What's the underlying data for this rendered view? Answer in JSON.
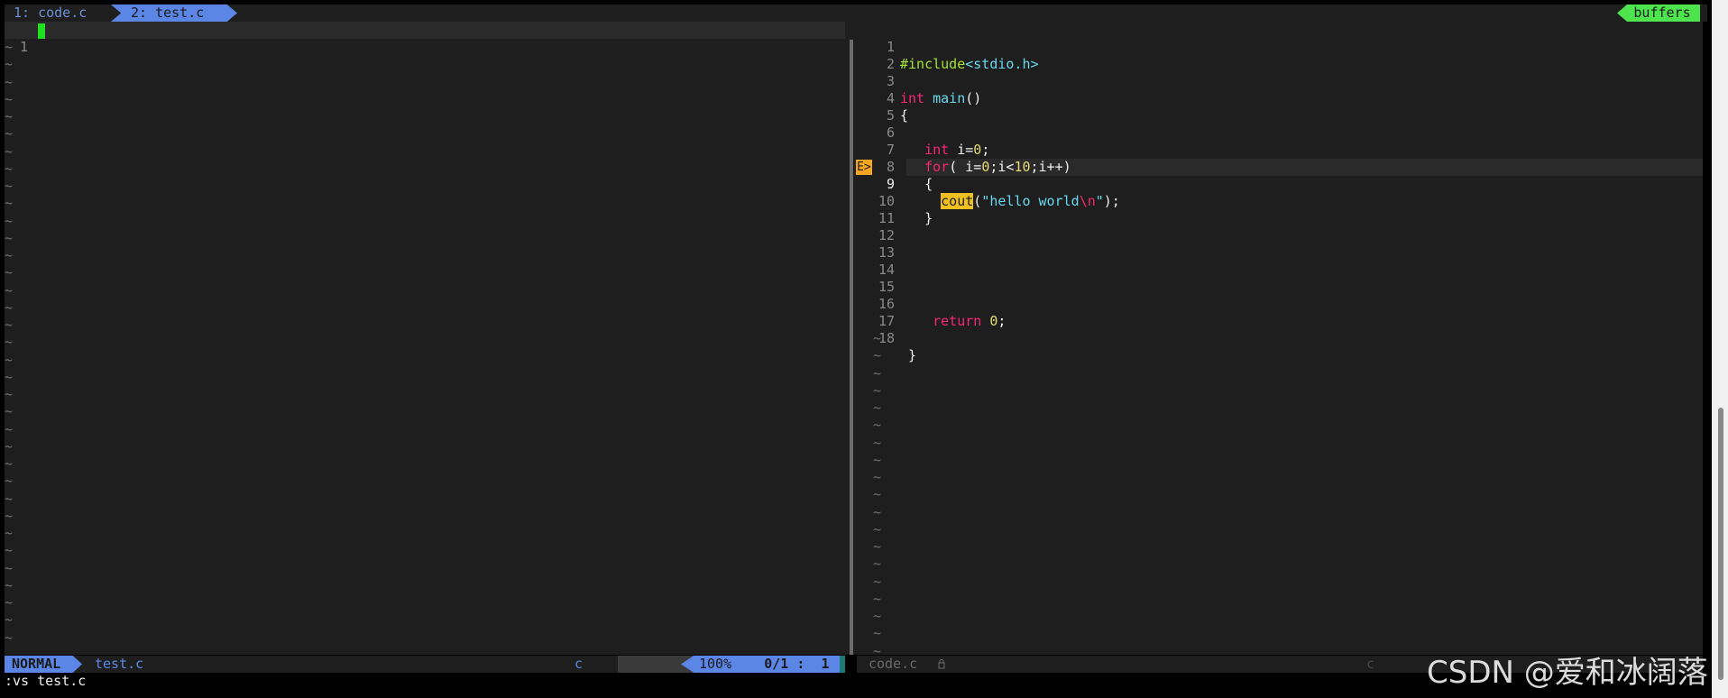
{
  "tabline": {
    "tab1": "1: code.c",
    "tab2": "2: test.c",
    "buffers": "buffers"
  },
  "left_pane": {
    "line_number": "1"
  },
  "right_pane": {
    "lines": [
      {
        "n": "1",
        "code": "#include<stdio.h>"
      },
      {
        "n": "2",
        "code": ""
      },
      {
        "n": "3",
        "code": "int main()"
      },
      {
        "n": "4",
        "code": "{"
      },
      {
        "n": "5",
        "code": ""
      },
      {
        "n": "6",
        "code": "   int i=0;"
      },
      {
        "n": "7",
        "code": "   for( i=0;i<10;i++)"
      },
      {
        "n": "8",
        "code": "   {"
      },
      {
        "n": "9",
        "code": "     cout(\"hello world\\n\");"
      },
      {
        "n": "10",
        "code": "   }"
      },
      {
        "n": "11",
        "code": ""
      },
      {
        "n": "12",
        "code": ""
      },
      {
        "n": "13",
        "code": ""
      },
      {
        "n": "14",
        "code": ""
      },
      {
        "n": "15",
        "code": ""
      },
      {
        "n": "16",
        "code": "    return 0;"
      },
      {
        "n": "17",
        "code": ""
      },
      {
        "n": "18",
        "code": " }"
      }
    ],
    "error_sign": "E>"
  },
  "statusline": {
    "mode": "NORMAL",
    "filename": "test.c",
    "filetype": "c",
    "percent": "100%",
    "position": "0/1 :  1",
    "right_filename": "code.c",
    "right_filetype": "c"
  },
  "cmdline": ":vs test.c",
  "watermark": "CSDN @爱和冰阔落",
  "colors": {
    "background": "#1e1e1e",
    "accent_blue": "#5c86e6",
    "accent_green": "#4ee44e",
    "cursor_green": "#20e020",
    "error_sign": "#f5a623"
  }
}
